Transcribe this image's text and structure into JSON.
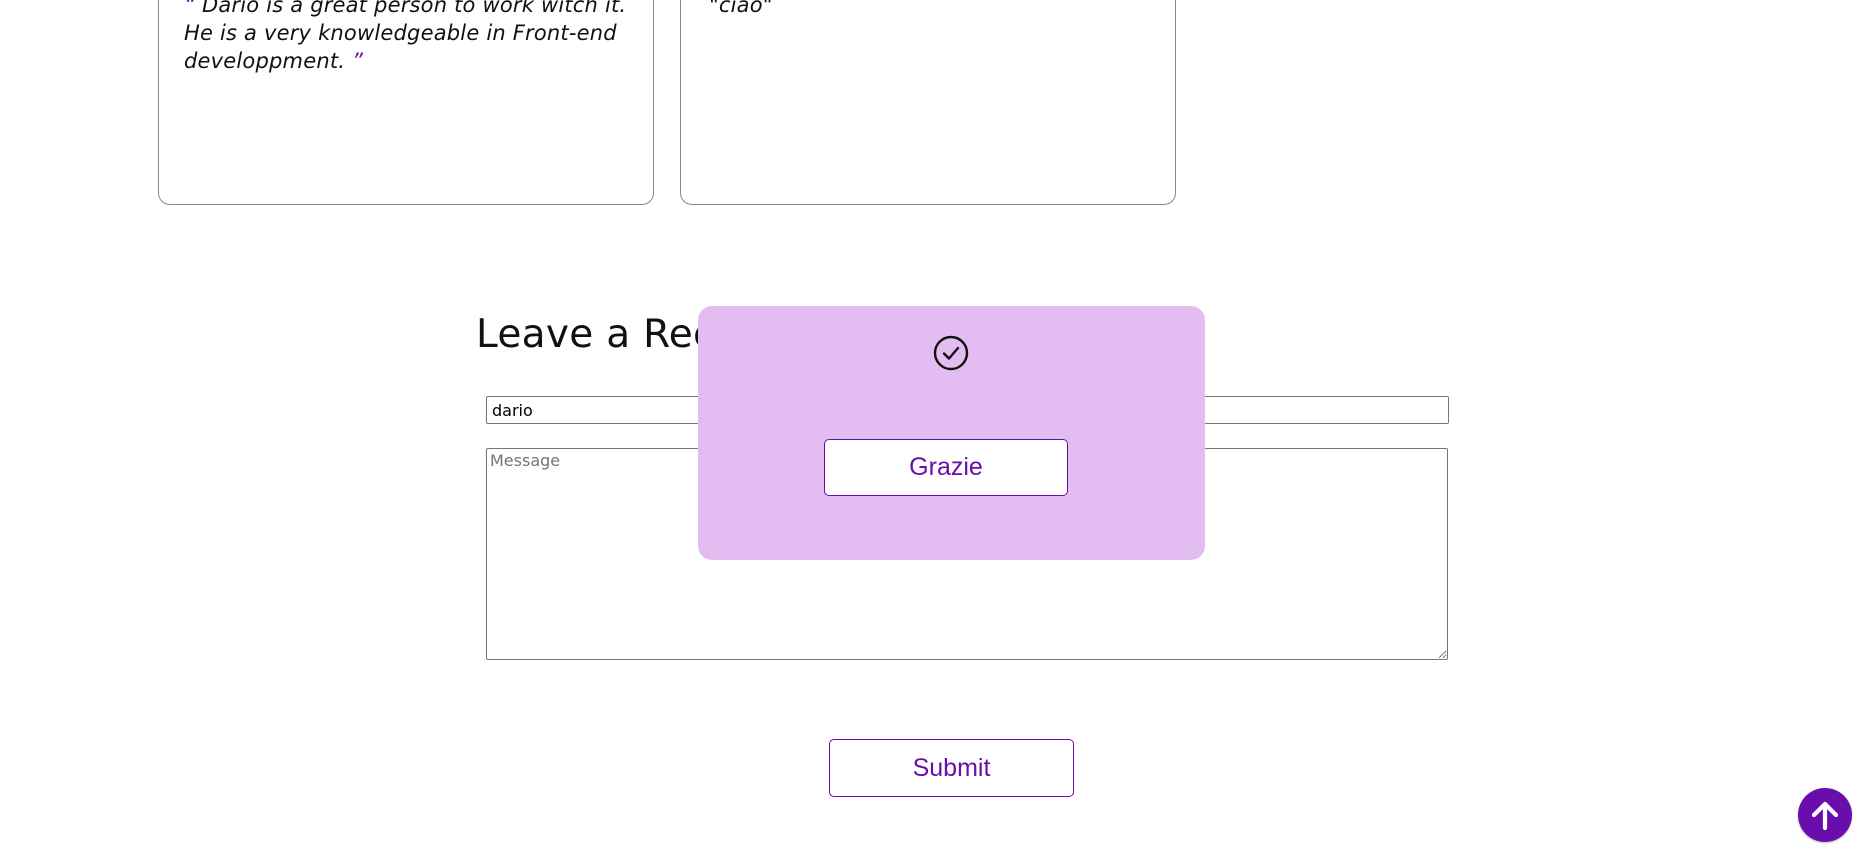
{
  "recommendations": [
    {
      "open_quote": "“",
      "text": " Dario is a great person to work witch it. He is a very knowledgeable in Front-end developpment. ",
      "close_quote": "”"
    },
    {
      "text": "\"ciao\""
    }
  ],
  "form": {
    "title": "Leave a Recommendation",
    "name_value": "dario",
    "message_placeholder": "Message",
    "submit_label": "Submit"
  },
  "toast": {
    "icon": "check-circle-icon",
    "button_label": "Grazie",
    "background_color": "#e3bdf1"
  },
  "back_to_top": {
    "icon": "arrow-up-icon",
    "color": "#6a0dad"
  },
  "colors": {
    "accent": "#6a0dad"
  }
}
